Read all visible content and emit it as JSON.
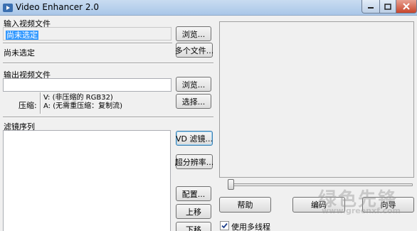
{
  "window": {
    "title": "Video Enhancer 2.0"
  },
  "input": {
    "header": "输入视频文件",
    "file_value": "尚未选定",
    "browse_label": "浏览...",
    "status_text": "尚未选定",
    "multi_files_label": "多个文件..."
  },
  "output": {
    "header": "输出视频文件",
    "file_value": "",
    "browse_label": "浏览...",
    "compress_label": "压缩:",
    "compress_info": "V: (非压缩的 RGB32)\nA: (无需重压缩：复制流)",
    "choose_label": "选择..."
  },
  "filters": {
    "header": "滤镜序列",
    "vd_filters_label": "VD 滤镜...",
    "super_res_label": "超分辨率...",
    "configure_label": "配置...",
    "move_up_label": "上移",
    "move_down_label": "下移"
  },
  "preview": {
    "help_label": "帮助",
    "start_label": "编码",
    "wizard_label": "向导",
    "multithread_label": "使用多线程",
    "multithread_checked": true,
    "slider_position": 0
  },
  "watermark": {
    "brand": "绿色先锋",
    "url": "www.greenxf.com"
  }
}
